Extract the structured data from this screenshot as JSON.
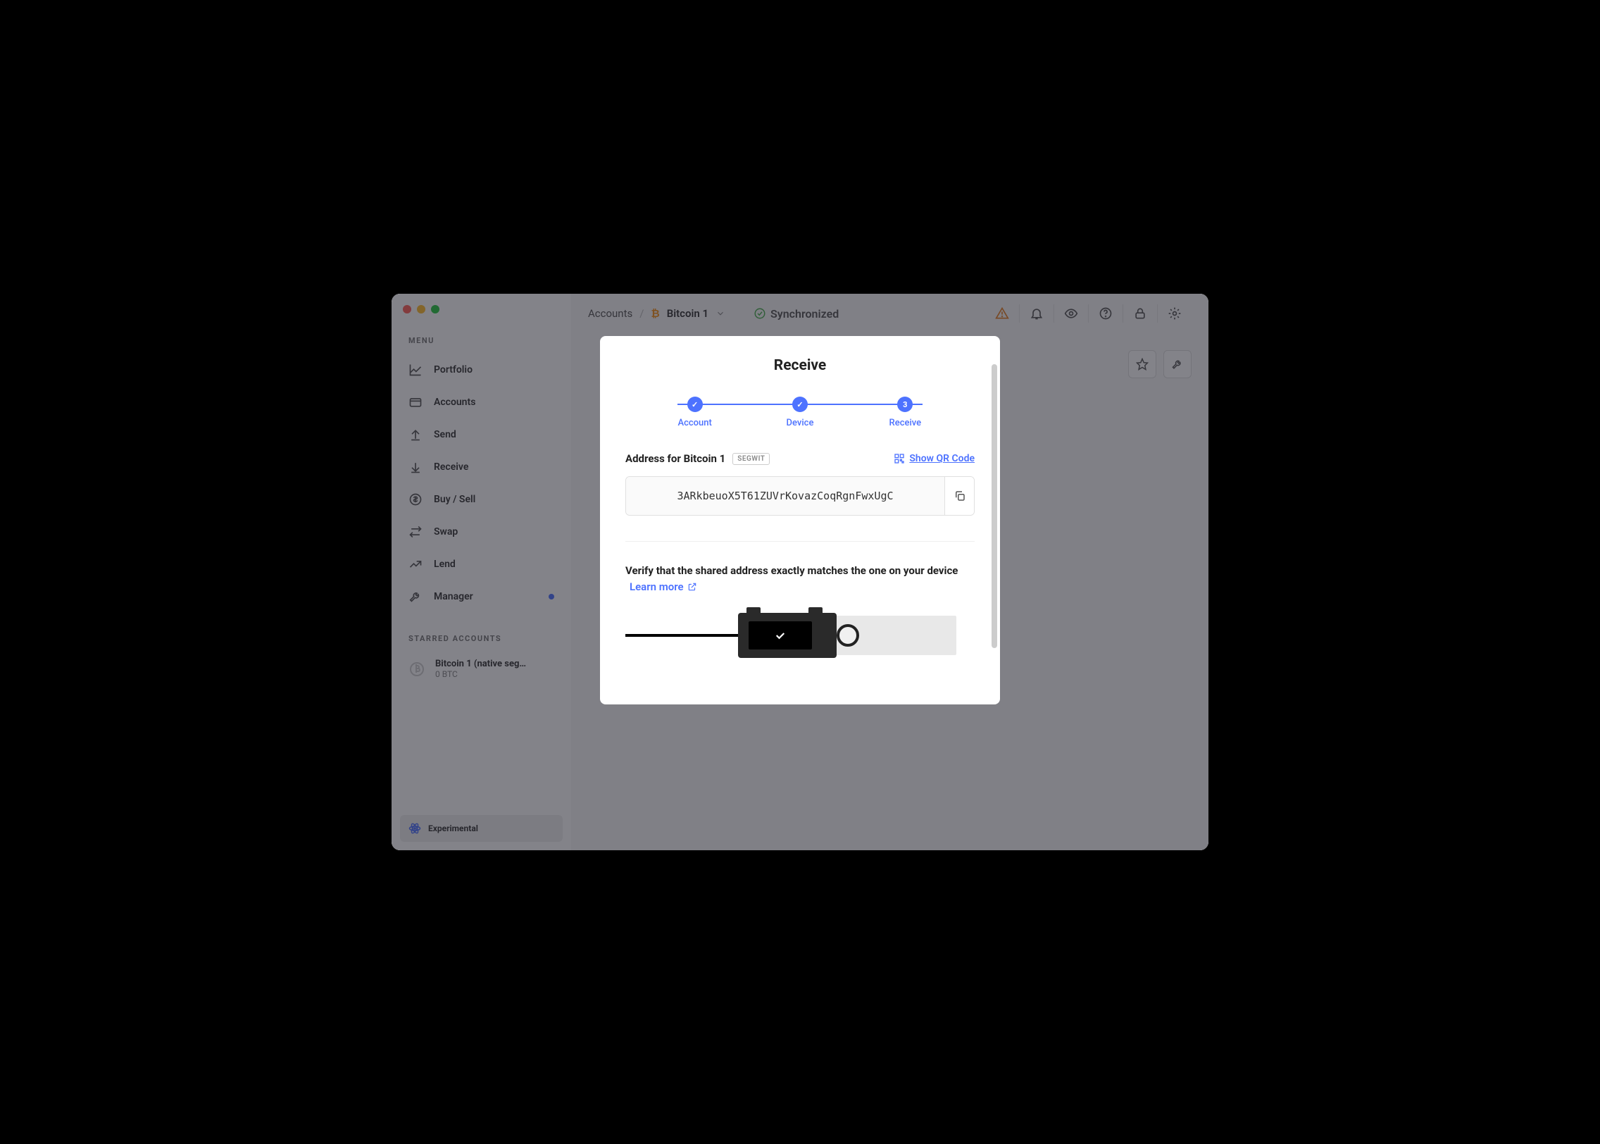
{
  "sidebar": {
    "menuLabel": "MENU",
    "items": [
      {
        "label": "Portfolio"
      },
      {
        "label": "Accounts"
      },
      {
        "label": "Send"
      },
      {
        "label": "Receive"
      },
      {
        "label": "Buy / Sell"
      },
      {
        "label": "Swap"
      },
      {
        "label": "Lend"
      },
      {
        "label": "Manager"
      }
    ],
    "starredLabel": "STARRED ACCOUNTS",
    "starred": {
      "name": "Bitcoin 1 (native seg…",
      "balance": "0 BTC"
    },
    "experimental": "Experimental"
  },
  "topbar": {
    "breadcrumb": {
      "root": "Accounts",
      "coin": "₿",
      "account": "Bitcoin 1"
    },
    "sync": "Synchronized"
  },
  "modal": {
    "title": "Receive",
    "steps": [
      {
        "label": "Account",
        "done": true
      },
      {
        "label": "Device",
        "done": true
      },
      {
        "label": "Receive",
        "num": "3"
      }
    ],
    "addressTitle": "Address for Bitcoin 1",
    "badge": "SEGWIT",
    "showQr": "Show QR Code",
    "address": "3ARkbeuoX5T61ZUVrKovazCoqRgnFwxUgC",
    "verify": "Verify that the shared address exactly matches the one on your device",
    "learnMore": "Learn more"
  }
}
